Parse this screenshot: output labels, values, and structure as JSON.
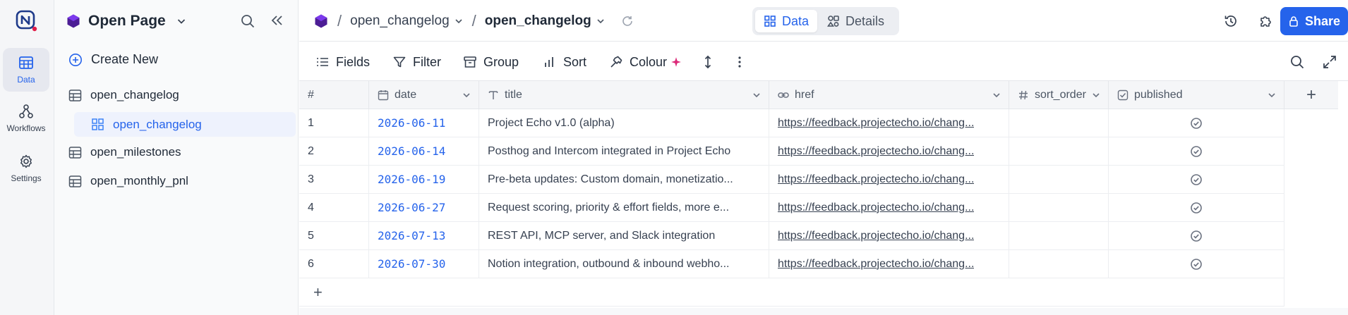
{
  "rail": {
    "items": [
      {
        "label": "Data",
        "icon": "table-icon"
      },
      {
        "label": "Workflows",
        "icon": "workflow-icon"
      },
      {
        "label": "Settings",
        "icon": "gear-icon"
      }
    ]
  },
  "sidebar": {
    "workspace": "Open Page",
    "create_new": "Create New",
    "tables": [
      {
        "label": "open_changelog"
      },
      {
        "label": "open_changelog"
      },
      {
        "label": "open_milestones"
      },
      {
        "label": "open_monthly_pnl"
      }
    ]
  },
  "header": {
    "breadcrumb_base": "open_changelog",
    "breadcrumb_view": "open_changelog",
    "tabs": {
      "data": "Data",
      "details": "Details"
    },
    "share": "Share"
  },
  "toolbar": {
    "fields": "Fields",
    "filter": "Filter",
    "group": "Group",
    "sort": "Sort",
    "colour": "Colour"
  },
  "table": {
    "columns": {
      "index": "#",
      "date": "date",
      "title": "title",
      "href": "href",
      "sort_order": "sort_order",
      "published": "published"
    },
    "rows": [
      {
        "n": "1",
        "date": "2026-06-11",
        "title": "Project Echo v1.0 (alpha)",
        "href": "https://feedback.projectecho.io/chang...",
        "sort_order": "",
        "published": true
      },
      {
        "n": "2",
        "date": "2026-06-14",
        "title": "Posthog and Intercom integrated in Project Echo",
        "href": "https://feedback.projectecho.io/chang...",
        "sort_order": "",
        "published": true
      },
      {
        "n": "3",
        "date": "2026-06-19",
        "title": "Pre-beta updates: Custom domain, monetizatio...",
        "href": "https://feedback.projectecho.io/chang...",
        "sort_order": "",
        "published": true
      },
      {
        "n": "4",
        "date": "2026-06-27",
        "title": "Request scoring, priority & effort fields, more e...",
        "href": "https://feedback.projectecho.io/chang...",
        "sort_order": "",
        "published": true
      },
      {
        "n": "5",
        "date": "2026-07-13",
        "title": "REST API, MCP server, and Slack integration",
        "href": "https://feedback.projectecho.io/chang...",
        "sort_order": "",
        "published": true
      },
      {
        "n": "6",
        "date": "2026-07-30",
        "title": "Notion integration, outbound & inbound webho...",
        "href": "https://feedback.projectecho.io/chang...",
        "sort_order": "",
        "published": true
      }
    ],
    "add_row": "+",
    "add_column": "+"
  },
  "colors": {
    "accent": "#2563eb",
    "logo_dot": "#e11d48",
    "cube": "#4c1d95",
    "sparkle": "#db2777"
  }
}
